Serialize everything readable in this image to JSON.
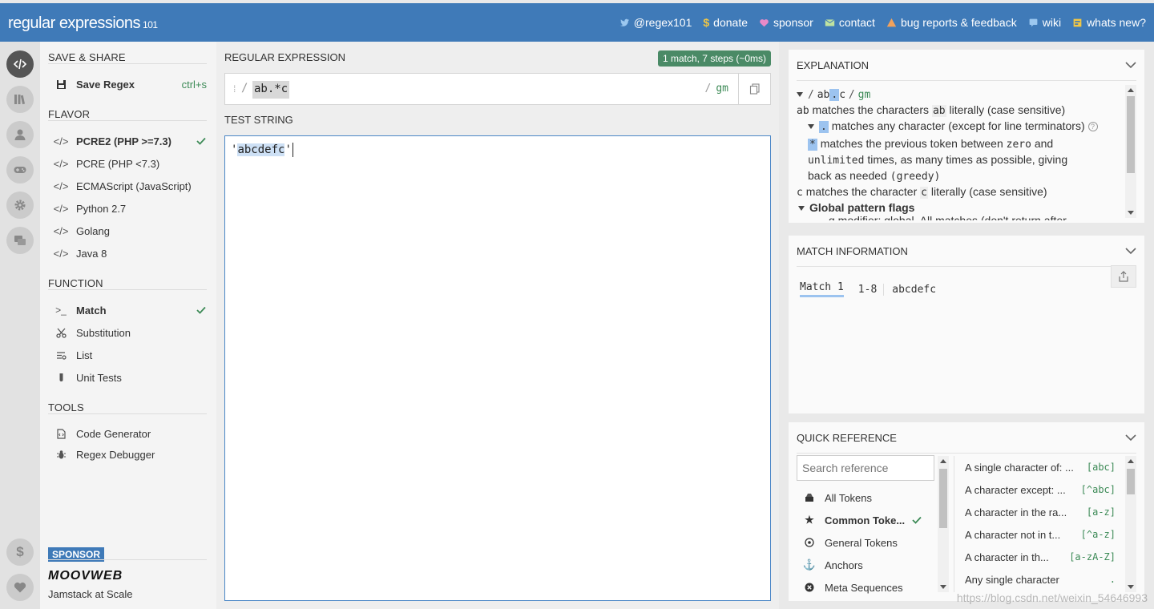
{
  "app": {
    "brand": "regular expressions",
    "version": "101"
  },
  "header_links": [
    {
      "label": "@regex101",
      "icon": "twitter-icon",
      "color": "#9cc8f0"
    },
    {
      "label": "donate",
      "icon": "dollar-icon",
      "color": "#f2c744"
    },
    {
      "label": "sponsor",
      "icon": "heart-icon",
      "color": "#e98ac8"
    },
    {
      "label": "contact",
      "icon": "mail-icon",
      "color": "#bfe3a0"
    },
    {
      "label": "bug reports & feedback",
      "icon": "warning-icon",
      "color": "#f2a25c"
    },
    {
      "label": "wiki",
      "icon": "wiki-icon",
      "color": "#9cc8f0"
    },
    {
      "label": "whats new?",
      "icon": "news-icon",
      "color": "#f2c744"
    }
  ],
  "sidebar": {
    "save_share": {
      "heading": "SAVE & SHARE",
      "save_label": "Save Regex",
      "save_shortcut": "ctrl+s"
    },
    "flavor": {
      "heading": "FLAVOR",
      "items": [
        {
          "label": "PCRE2 (PHP >=7.3)",
          "selected": true
        },
        {
          "label": "PCRE (PHP <7.3)",
          "selected": false
        },
        {
          "label": "ECMAScript (JavaScript)",
          "selected": false
        },
        {
          "label": "Python 2.7",
          "selected": false
        },
        {
          "label": "Golang",
          "selected": false
        },
        {
          "label": "Java 8",
          "selected": false
        }
      ]
    },
    "function": {
      "heading": "FUNCTION",
      "items": [
        {
          "label": "Match",
          "icon": "prompt-icon",
          "selected": true
        },
        {
          "label": "Substitution",
          "icon": "scissors-icon",
          "selected": false
        },
        {
          "label": "List",
          "icon": "list-icon",
          "selected": false
        },
        {
          "label": "Unit Tests",
          "icon": "flask-icon",
          "selected": false
        }
      ]
    },
    "tools": {
      "heading": "TOOLS",
      "items": [
        {
          "label": "Code Generator",
          "icon": "code-file-icon"
        },
        {
          "label": "Regex Debugger",
          "icon": "bug-icon"
        }
      ]
    },
    "sponsor": {
      "badge": "SPONSOR",
      "name": "MOOVWEB",
      "tagline": "Jamstack at Scale"
    }
  },
  "editor": {
    "regex_heading": "REGULAR EXPRESSION",
    "match_badge": "1 match, 7 steps (~0ms)",
    "delimiter": "/",
    "regex_value": "ab.*c",
    "flags": "gm",
    "test_heading": "TEST STRING",
    "test_prefix": "'",
    "test_match": "abcdefc",
    "test_suffix": "'"
  },
  "explanation": {
    "heading": "EXPLANATION",
    "lines": {
      "root_slash1": "/",
      "root_ab": "ab",
      "root_dot": ".",
      "root_c": "c",
      "root_slash2": "/",
      "root_flags": "gm",
      "ab_tok": "ab",
      "ab_pre": "matches the characters",
      "ab_tok2": "ab",
      "ab_post": "literally (case sensitive)",
      "dot_tok": ".",
      "dot_text": "matches any character (except for line terminators)",
      "star_tok": "*",
      "star_text1": "matches the previous token between",
      "star_zero": "zero",
      "star_and": "and",
      "star_unlimited": "unlimited",
      "star_text2": "times, as many times as possible, giving",
      "star_text3": "back as needed",
      "star_greedy": "(greedy)",
      "c_tok": "c",
      "c_pre": "matches the character",
      "c_tok2": "c",
      "c_post": "literally (case sensitive)",
      "flags_heading": "Global pattern flags",
      "flags_cut": "g modifier: global. All matches (don't return after"
    }
  },
  "match_info": {
    "heading": "MATCH INFORMATION",
    "match_label": "Match 1",
    "range": "1-8",
    "value": "abcdefc"
  },
  "quick_reference": {
    "heading": "QUICK REFERENCE",
    "search_placeholder": "Search reference",
    "categories": [
      {
        "label": "All Tokens",
        "icon": "stack-icon",
        "selected": false
      },
      {
        "label": "Common Toke...",
        "icon": "star-icon",
        "selected": true
      },
      {
        "label": "General Tokens",
        "icon": "target-icon",
        "selected": false
      },
      {
        "label": "Anchors",
        "icon": "anchor-icon",
        "selected": false
      },
      {
        "label": "Meta Sequences",
        "icon": "meta-icon",
        "selected": false
      }
    ],
    "tokens": [
      {
        "desc": "A single character of: ...",
        "token": "[abc]"
      },
      {
        "desc": "A character except: ...",
        "token": "[^abc]"
      },
      {
        "desc": "A character in the ra...",
        "token": "[a-z]"
      },
      {
        "desc": "A character not in t...",
        "token": "[^a-z]"
      },
      {
        "desc": "A character in th...",
        "token": "[a-zA-Z]"
      },
      {
        "desc": "Any single character",
        "token": "."
      }
    ]
  },
  "watermark": "https://blog.csdn.net/weixin_54646993",
  "colors": {
    "header": "#3f7ab8",
    "accent_green": "#3c8a56",
    "match_highlight": "#9cc3ef"
  }
}
